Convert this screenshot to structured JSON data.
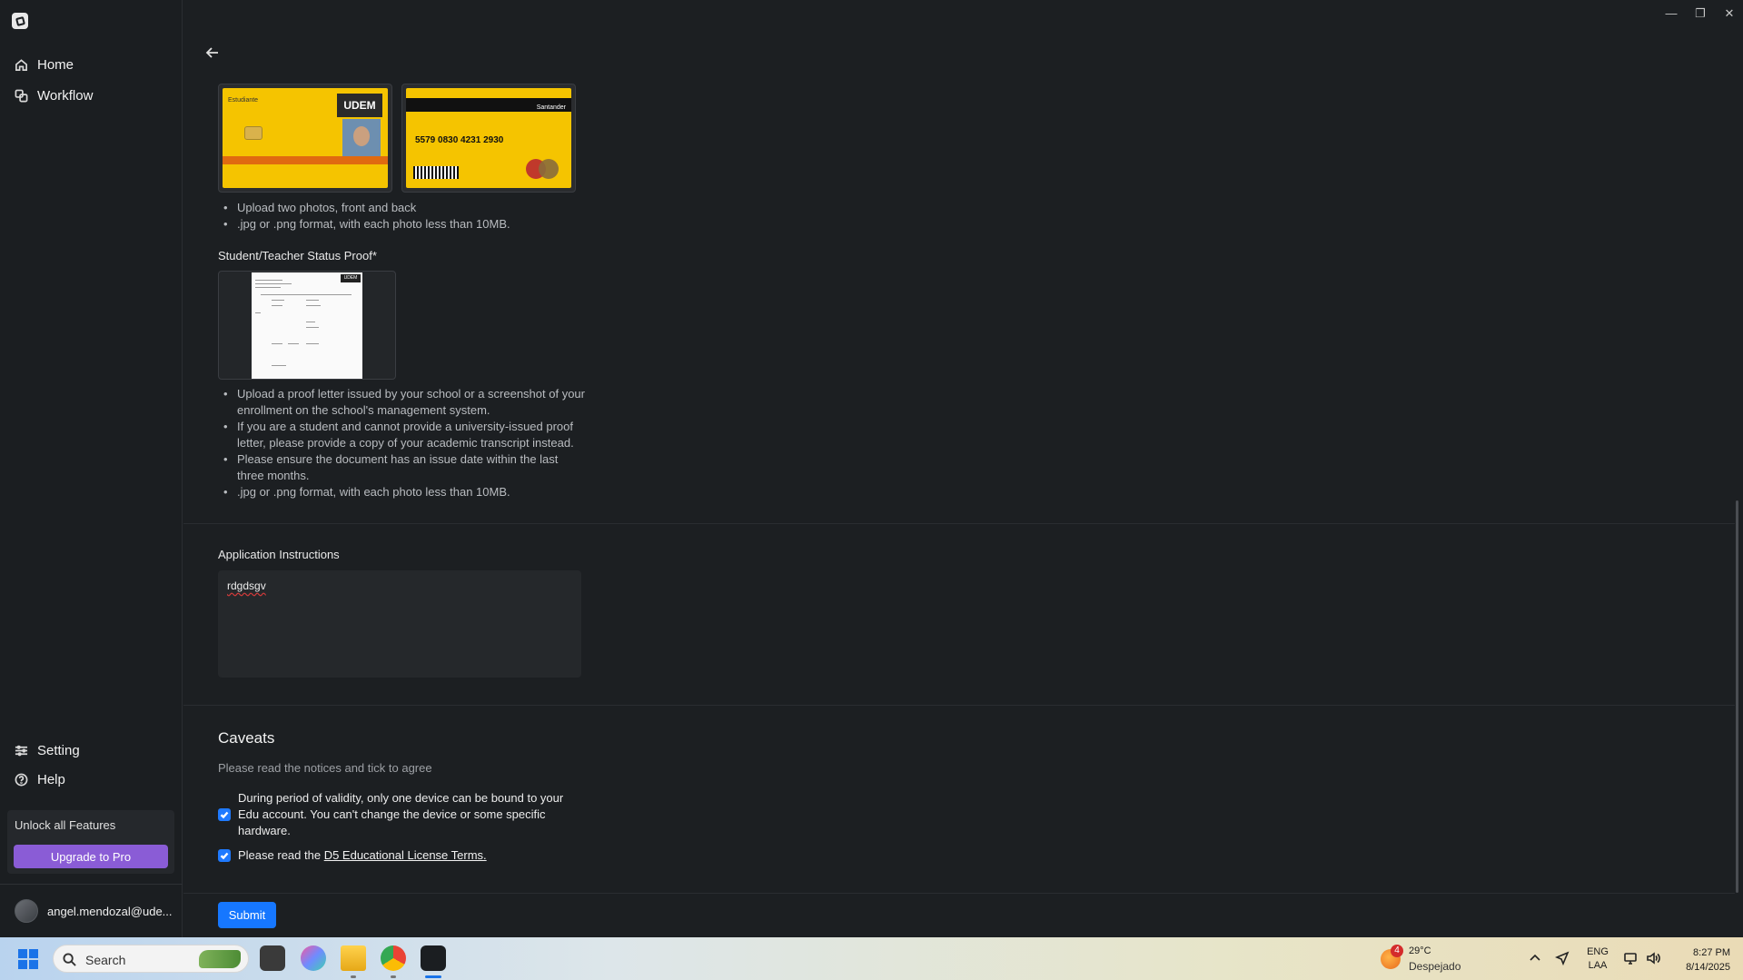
{
  "window": {
    "minimize_glyph": "—",
    "restore_glyph": "❐",
    "close_glyph": "✕"
  },
  "sidebar": {
    "items": [
      {
        "label": "Home",
        "icon": "home-icon"
      },
      {
        "label": "Workflow",
        "icon": "workflow-icon"
      }
    ],
    "bottom_items": [
      {
        "label": "Setting",
        "icon": "sliders-icon"
      },
      {
        "label": "Help",
        "icon": "help-icon"
      }
    ],
    "unlock_text": "Unlock all Features",
    "upgrade_label": "Upgrade to Pro",
    "user_name": "angel.mendozal@ude..."
  },
  "id_card": {
    "front_logo": "UDEM",
    "front_label": "Estudiante",
    "back_number": "5579 0830 4231 2930",
    "back_brand": "Santander",
    "bullets": [
      "Upload two photos, front and back",
      ".jpg or .png format, with each photo less than 10MB."
    ]
  },
  "status_proof": {
    "label": "Student/Teacher Status Proof*",
    "doc_badge": "UDEM",
    "bullets": [
      "Upload a proof letter issued by your school or a screenshot of your enrollment on the school's management system.",
      "If you are a student and cannot provide a university-issued proof letter, please provide a copy of your academic transcript instead.",
      "Please ensure the document has an issue date within the last three months.",
      ".jpg or .png format, with each photo less than 10MB."
    ]
  },
  "instructions": {
    "label": "Application Instructions",
    "value": "rdgdsgv"
  },
  "caveats": {
    "title": "Caveats",
    "subtitle": "Please read the notices and tick to agree",
    "item1": "During period of validity, only one device can be bound to your Edu account. You can't change the device or some specific hardware.",
    "item2_prefix": "Please read the ",
    "item2_link": "D5 Educational License Terms.",
    "item1_checked": true,
    "item2_checked": true
  },
  "submit_label": "Submit",
  "taskbar": {
    "search_placeholder": "Search",
    "weather_badge": "4",
    "weather_temp": "29°C",
    "weather_desc": "Despejado",
    "lang_line1": "ENG",
    "lang_line2": "LAA",
    "time": "8:27 PM",
    "date": "8/14/2025"
  },
  "colors": {
    "accent": "#1677ff",
    "upgrade": "#8a5cd6",
    "background": "#1c1f22"
  }
}
